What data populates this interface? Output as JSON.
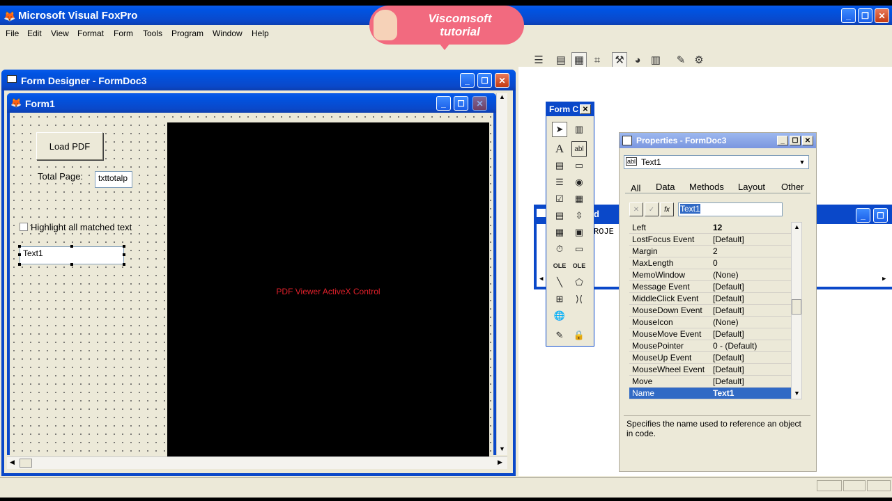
{
  "app": {
    "title": "Microsoft Visual FoxPro",
    "menus": [
      "File",
      "Edit",
      "View",
      "Format",
      "Form",
      "Tools",
      "Program",
      "Window",
      "Help"
    ]
  },
  "overlay": {
    "brand": "Viscomsoft",
    "subtitle": "tutorial"
  },
  "designer": {
    "title": "Form Designer - FormDoc3",
    "form_title": "Form1",
    "load_button": "Load PDF",
    "total_page_label": "Total Page:",
    "total_page_value": "txttotalp",
    "highlight_label": "Highlight all matched text",
    "text1_value": "Text1",
    "activex_label": "PDF Viewer ActiveX Control"
  },
  "toolbox": {
    "title": "Form C"
  },
  "command_window": {
    "title_partial": "d",
    "text": "ROJE"
  },
  "properties": {
    "title": "Properties - FormDoc3",
    "object": "Text1",
    "tabs": [
      "All",
      "Data",
      "Methods",
      "Layout",
      "Other"
    ],
    "edit_value": "Text1",
    "fx_label": "fx",
    "rows": [
      {
        "name": "Left",
        "value": "12",
        "bold": true
      },
      {
        "name": "LostFocus Event",
        "value": "[Default]"
      },
      {
        "name": "Margin",
        "value": "2"
      },
      {
        "name": "MaxLength",
        "value": "0"
      },
      {
        "name": "MemoWindow",
        "value": "(None)"
      },
      {
        "name": "Message Event",
        "value": "[Default]"
      },
      {
        "name": "MiddleClick Event",
        "value": "[Default]"
      },
      {
        "name": "MouseDown Event",
        "value": "[Default]"
      },
      {
        "name": "MouseIcon",
        "value": "(None)"
      },
      {
        "name": "MouseMove Event",
        "value": "[Default]"
      },
      {
        "name": "MousePointer",
        "value": "0 - (Default)"
      },
      {
        "name": "MouseUp Event",
        "value": "[Default]"
      },
      {
        "name": "MouseWheel Event",
        "value": "[Default]"
      },
      {
        "name": "Move",
        "value": "[Default]"
      },
      {
        "name": "Name",
        "value": "Text1",
        "selected": true
      }
    ],
    "description": "Specifies the name used to reference an object in code."
  }
}
